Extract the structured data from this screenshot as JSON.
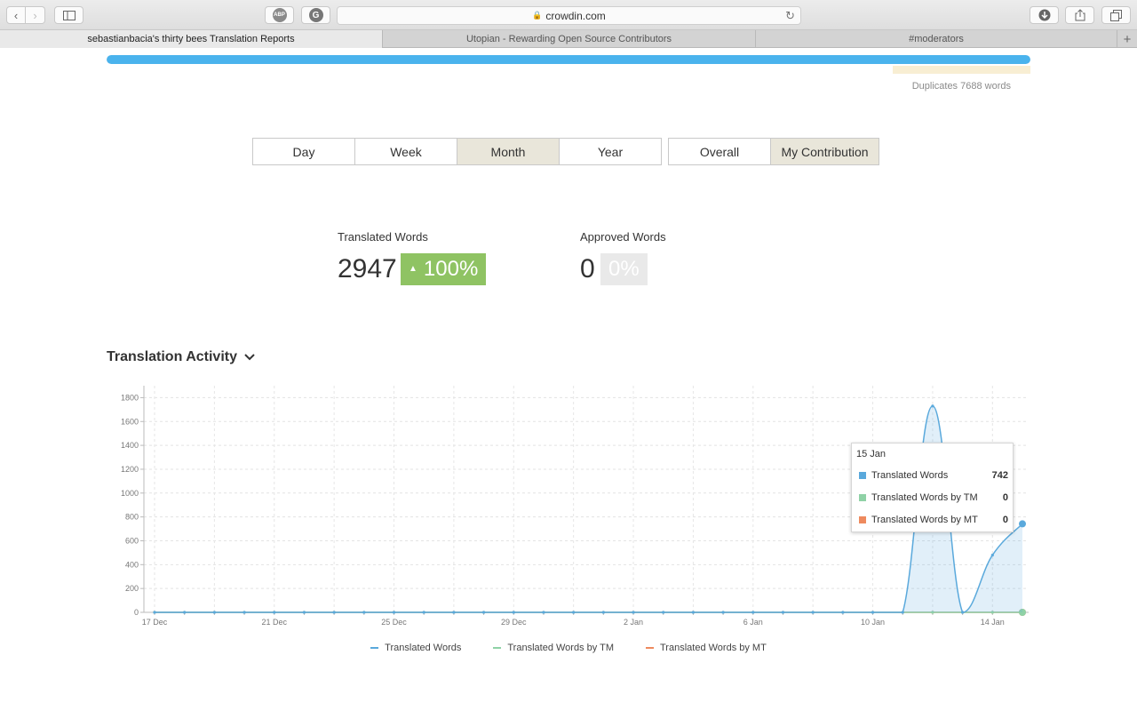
{
  "browser": {
    "url": "crowdin.com",
    "tabs": [
      {
        "title": "sebastianbacia's thirty bees Translation Reports",
        "active": true
      },
      {
        "title": "Utopian - Rewarding Open Source Contributors",
        "active": false
      },
      {
        "title": "#moderators",
        "active": false
      }
    ],
    "abp_label": "ABP",
    "grammarly_label": "G"
  },
  "progress": {
    "fill_fraction": 1.0,
    "duplicates_label": "Duplicates 7688 words"
  },
  "period_buttons": [
    {
      "label": "Day",
      "active": false
    },
    {
      "label": "Week",
      "active": false
    },
    {
      "label": "Month",
      "active": true
    },
    {
      "label": "Year",
      "active": false
    }
  ],
  "scope_buttons": [
    {
      "label": "Overall",
      "active": false
    },
    {
      "label": "My Contribution",
      "active": true
    }
  ],
  "stats": {
    "translated": {
      "label": "Translated Words",
      "value": "2947",
      "change": "100%"
    },
    "approved": {
      "label": "Approved Words",
      "value": "0",
      "change": "0%"
    }
  },
  "section_title": "Translation Activity",
  "colors": {
    "translated": "#5aa9dc",
    "tm": "#8fd2a6",
    "mt": "#ee8a5e",
    "accent_blue": "#4ab3ed",
    "badge_green": "#8fc363"
  },
  "tooltip": {
    "date": "15 Jan",
    "rows": [
      {
        "name": "Translated Words",
        "value": "742",
        "color": "#5aa9dc"
      },
      {
        "name": "Translated Words by TM",
        "value": "0",
        "color": "#8fd2a6"
      },
      {
        "name": "Translated Words by MT",
        "value": "0",
        "color": "#ee8a5e"
      }
    ]
  },
  "chart_data": {
    "type": "area",
    "ylim": [
      0,
      1900
    ],
    "y_ticks": [
      0,
      200,
      400,
      600,
      800,
      1000,
      1200,
      1400,
      1600,
      1800
    ],
    "x_tick_labels": [
      "17 Dec",
      "21 Dec",
      "25 Dec",
      "29 Dec",
      "2 Jan",
      "6 Jan",
      "10 Jan",
      "14 Jan"
    ],
    "x": [
      "17 Dec",
      "18 Dec",
      "19 Dec",
      "20 Dec",
      "21 Dec",
      "22 Dec",
      "23 Dec",
      "24 Dec",
      "25 Dec",
      "26 Dec",
      "27 Dec",
      "28 Dec",
      "29 Dec",
      "30 Dec",
      "31 Dec",
      "1 Jan",
      "2 Jan",
      "3 Jan",
      "4 Jan",
      "5 Jan",
      "6 Jan",
      "7 Jan",
      "8 Jan",
      "9 Jan",
      "10 Jan",
      "11 Jan",
      "12 Jan",
      "13 Jan",
      "14 Jan",
      "15 Jan"
    ],
    "series": [
      {
        "name": "Translated Words",
        "values": [
          0,
          0,
          0,
          0,
          0,
          0,
          0,
          0,
          0,
          0,
          0,
          0,
          0,
          0,
          0,
          0,
          0,
          0,
          0,
          0,
          0,
          0,
          0,
          0,
          0,
          0,
          1730,
          0,
          480,
          742
        ]
      },
      {
        "name": "Translated Words by TM",
        "values": [
          0,
          0,
          0,
          0,
          0,
          0,
          0,
          0,
          0,
          0,
          0,
          0,
          0,
          0,
          0,
          0,
          0,
          0,
          0,
          0,
          0,
          0,
          0,
          0,
          0,
          0,
          0,
          0,
          0,
          0
        ]
      },
      {
        "name": "Translated Words by MT",
        "values": [
          0,
          0,
          0,
          0,
          0,
          0,
          0,
          0,
          0,
          0,
          0,
          0,
          0,
          0,
          0,
          0,
          0,
          0,
          0,
          0,
          0,
          0,
          0,
          0,
          0,
          0,
          0,
          0,
          0,
          0
        ]
      }
    ],
    "grid": true,
    "legend_position": "bottom"
  }
}
